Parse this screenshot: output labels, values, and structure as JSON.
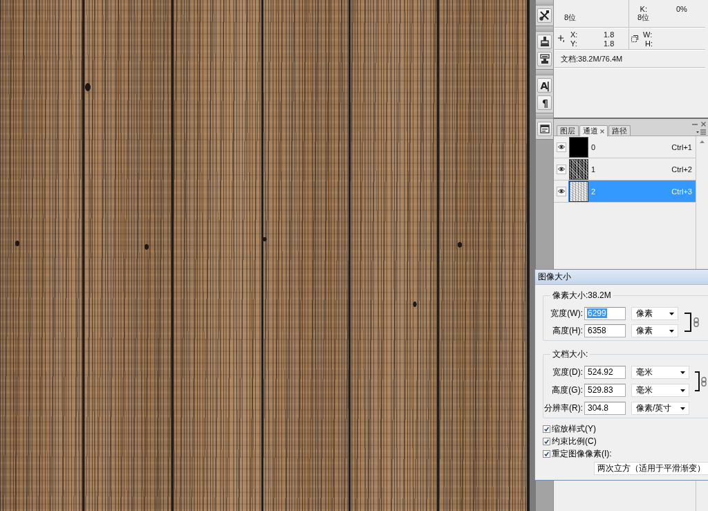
{
  "info_panel": {
    "bit_depth_left": "8位",
    "k_label": "K:",
    "k_value": "0%",
    "bit_depth_right": "8位",
    "x_label": "X:",
    "x_value": "1.8",
    "y_label": "Y:",
    "y_value": "1.8",
    "w_label": "W:",
    "h_label": "H:",
    "document_size": "文档:38.2M/76.4M"
  },
  "toolstrip": {
    "glyph_buttons": [
      "A|",
      "¶"
    ]
  },
  "channels_panel": {
    "tabs": [
      {
        "label": "图层",
        "selected": false
      },
      {
        "label": "通道",
        "selected": true
      },
      {
        "label": "路径",
        "selected": false
      }
    ],
    "channels": [
      {
        "name": "0",
        "shortcut": "Ctrl+1",
        "visible": true,
        "selected": false,
        "kind": "solid"
      },
      {
        "name": "1",
        "shortcut": "Ctrl+2",
        "visible": true,
        "selected": false,
        "kind": "dark"
      },
      {
        "name": "2",
        "shortcut": "Ctrl+3",
        "visible": true,
        "selected": true,
        "kind": "light"
      }
    ]
  },
  "dialog": {
    "title": "图像大小",
    "groups": [
      {
        "legend": "像素大小:38.2M",
        "linked": true,
        "fields": [
          {
            "label": "宽度(W):",
            "value": "6299",
            "selected": true,
            "unit": "像素"
          },
          {
            "label": "高度(H):",
            "value": "6358",
            "selected": false,
            "unit": "像素"
          }
        ]
      },
      {
        "legend": "文档大小:",
        "linked": true,
        "fields": [
          {
            "label": "宽度(D):",
            "value": "524.92",
            "selected": false,
            "unit": "毫米"
          },
          {
            "label": "高度(G):",
            "value": "529.83",
            "selected": false,
            "unit": "毫米"
          },
          {
            "label": "分辨率(R):",
            "value": "304.8",
            "selected": false,
            "unit": "像素/英寸"
          }
        ]
      }
    ],
    "checkboxes": [
      {
        "label": "缩放样式(Y)",
        "checked": true
      },
      {
        "label": "约束比例(C)",
        "checked": true
      },
      {
        "label": "重定图像像素(I):",
        "checked": true
      }
    ],
    "resample_method": "两次立方（适用于平滑渐变）"
  }
}
